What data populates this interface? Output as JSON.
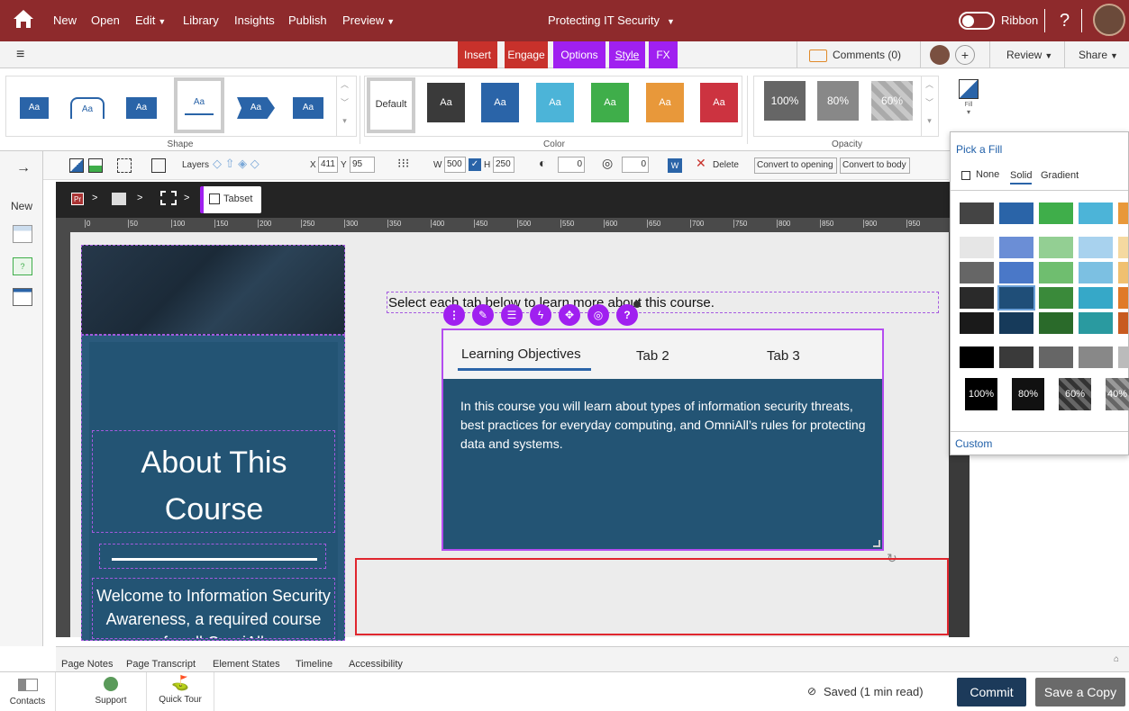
{
  "topbar": {
    "menu": [
      "New",
      "Open",
      "Edit",
      "Library",
      "Insights",
      "Publish",
      "Preview"
    ],
    "title": "Protecting IT Security",
    "ribbon_label": "Ribbon",
    "help": "?"
  },
  "bar2": {
    "tabs": [
      "Insert",
      "Engage",
      "Options",
      "Style",
      "FX"
    ],
    "comments": "Comments (0)",
    "review": "Review",
    "share": "Share",
    "add": "+"
  },
  "ribbon": {
    "shape_label": "Shape",
    "color_label": "Color",
    "opacity_label": "Opacity",
    "shape_samples": [
      "Aa",
      "Aa",
      "Aa",
      "Aa",
      "Aa",
      "Aa"
    ],
    "color_default": "Default",
    "color_samples": [
      "Aa",
      "Aa",
      "Aa",
      "Aa",
      "Aa",
      "Aa"
    ],
    "opacity_samples": [
      "100%",
      "80%",
      "60%"
    ],
    "fill_label": "Fill"
  },
  "toolbar": {
    "layers": "Layers",
    "x_label": "X",
    "x_value": "411",
    "y_label": "Y",
    "y_value": "95",
    "w_label": "W",
    "w_value": "500",
    "h_label": "H",
    "h_value": "250",
    "opacity_value": "0",
    "rotate_value": "0",
    "delete": "Delete",
    "convert_opening": "Convert to opening",
    "convert_body": "Convert to body"
  },
  "rail": {
    "new": "New"
  },
  "breadcrumb": {
    "tabset": "Tabset"
  },
  "ruler": {
    "marks": [
      "0",
      "50",
      "100",
      "150",
      "200",
      "250",
      "300",
      "350",
      "400",
      "450",
      "500",
      "550",
      "600",
      "650",
      "700",
      "750",
      "800",
      "850",
      "900",
      "950"
    ]
  },
  "slide": {
    "heading": "About This Course",
    "welcome": "Welcome to Information Security Awareness, a required course for all OmniAll",
    "instruction": "Select each tab below to learn more about this course.",
    "tabs": [
      "Learning Objectives",
      "Tab 2",
      "Tab 3"
    ],
    "body": "In this course you will learn about types of information security threats, best practices for everyday computing, and OmniAll’s rules for protecting data and systems."
  },
  "fill_popup": {
    "title": "Pick a Fill",
    "none": "None",
    "solid": "Solid",
    "gradient": "Gradient",
    "opacities": [
      "100%",
      "80%",
      "60%",
      "40%"
    ],
    "custom": "Custom"
  },
  "notes": {
    "tabs": [
      "Page Notes",
      "Page Transcript",
      "Element States",
      "Timeline",
      "Accessibility"
    ]
  },
  "status": {
    "contacts": "Contacts",
    "support": "Support",
    "quick_tour": "Quick Tour",
    "saved": "Saved (1 min read)",
    "commit": "Commit",
    "save_copy": "Save a Copy"
  },
  "colors": {
    "brand": "#8e2a2c",
    "style_tab": "#a020f0",
    "slide_blue": "#235474",
    "accent_blue": "#2a64a8",
    "selection": "#b44cf0"
  }
}
